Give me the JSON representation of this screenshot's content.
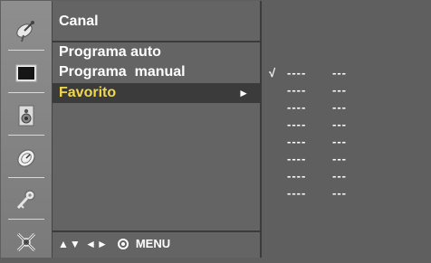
{
  "menu": {
    "title": "Canal",
    "items": [
      {
        "label": "Programa auto"
      },
      {
        "label": "Programa  manual"
      },
      {
        "label": "Favorito",
        "arrow": "►"
      }
    ],
    "footer": {
      "nav_arrows": "▲▼  ◄►",
      "menu_label": "MENU"
    }
  },
  "favorites": {
    "rows": [
      {
        "check": "√",
        "number": "----",
        "name": "---"
      },
      {
        "check": "",
        "number": "----",
        "name": "---"
      },
      {
        "check": "",
        "number": "----",
        "name": "---"
      },
      {
        "check": "",
        "number": "----",
        "name": "---"
      },
      {
        "check": "",
        "number": "----",
        "name": "---"
      },
      {
        "check": "",
        "number": "----",
        "name": "---"
      },
      {
        "check": "",
        "number": "----",
        "name": "---"
      },
      {
        "check": "",
        "number": "----",
        "name": "---"
      }
    ]
  },
  "sidebar": {
    "icons": [
      "satellite-dish-icon",
      "picture-icon",
      "speaker-icon",
      "clock-icon",
      "key-icon",
      "settings-icon"
    ]
  }
}
